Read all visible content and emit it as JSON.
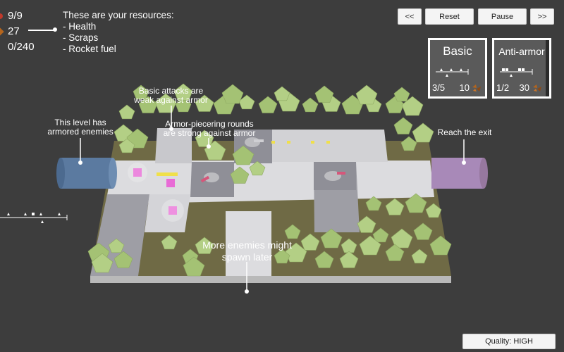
{
  "resources": {
    "health": "9/9",
    "scraps": "27",
    "rocket_fuel": "0/240",
    "health_color": "#c0392b",
    "scraps_color": "#b5651d"
  },
  "hint": {
    "title": "These are your resources:",
    "items": [
      "- Health",
      "- Scraps",
      "- Rocket fuel"
    ]
  },
  "controls": {
    "prev": "<<",
    "reset": "Reset",
    "pause": "Pause",
    "next": ">>"
  },
  "towers": [
    {
      "name": "Basic",
      "count": "3/5",
      "cost": "10"
    },
    {
      "name": "Anti-armor",
      "count": "1/2",
      "cost": "30"
    }
  ],
  "annotations": {
    "armored_enemies": "This level has\narmored enemies",
    "basic_weak": "Basic attacks are\nweak against armor",
    "armor_piercing": "Armor-piecering rounds\nare strong against armor",
    "reach_exit": "Reach the exit",
    "more_enemies": "More enemies might\nspawn later"
  },
  "quality": "Quality: HIGH",
  "colors": {
    "background": "#3d3d3d",
    "board_base": "#a7a7a7",
    "path": "#d9d9dc",
    "grass": "#6f6a45",
    "tree": "#a8c47a",
    "spawn_portal": "#5b7aa0",
    "exit_portal": "#a889b8",
    "enemy": "#e86bd6",
    "projectile": "#f0e04a"
  }
}
